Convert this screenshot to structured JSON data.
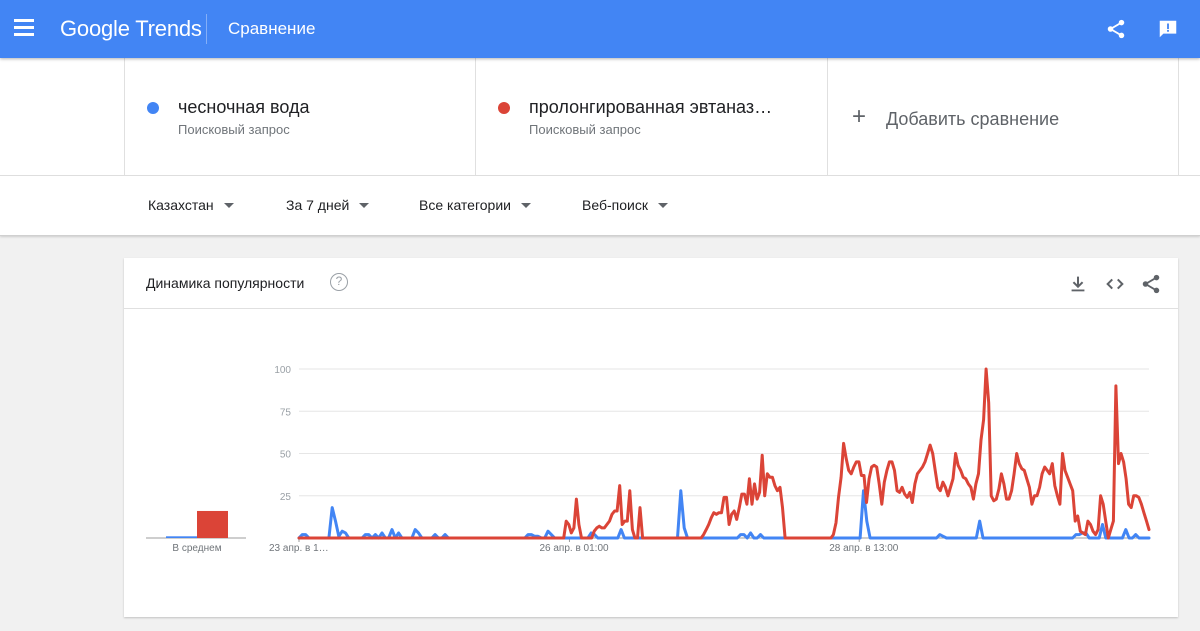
{
  "header": {
    "brand": "Google Trends",
    "page_title": "Сравнение",
    "accent_color": "#4285f4"
  },
  "terms": [
    {
      "name": "чесночная вода",
      "type": "Поисковый запрос",
      "color": "#4285f4"
    },
    {
      "name": "пролонгированная эвтаназ…",
      "type": "Поисковый запрос",
      "color": "#db4437"
    }
  ],
  "add_comparison": {
    "label": "Добавить сравнение",
    "icon": "plus-icon"
  },
  "filters": [
    {
      "label": "Казахстан"
    },
    {
      "label": "За 7 дней"
    },
    {
      "label": "Все категории"
    },
    {
      "label": "Веб-поиск"
    }
  ],
  "card": {
    "title": "Динамика популярности",
    "help_glyph": "?",
    "icons": [
      "download-icon",
      "embed-icon",
      "share-icon"
    ]
  },
  "chart_data": {
    "type": "line",
    "yticks": [
      "100",
      "75",
      "50",
      "25"
    ],
    "ylim": [
      0,
      100
    ],
    "xtick_labels": [
      "23 апр. в 1…",
      "26 апр. в 01:00",
      "28 апр. в 13:00"
    ],
    "xtick_positions": [
      0,
      28,
      58
    ],
    "average_label": "В среднем",
    "average_values": [
      1,
      16
    ],
    "grid": true,
    "series": [
      {
        "color": "#4285f4",
        "values": [
          0,
          2,
          2,
          0,
          0,
          0,
          0,
          0,
          0,
          0,
          18,
          10,
          1,
          4,
          3,
          0,
          0,
          0,
          0,
          0,
          2,
          2,
          0,
          2,
          0,
          3,
          0,
          0,
          5,
          0,
          3,
          0,
          0,
          0,
          0,
          5,
          3,
          0,
          0,
          0,
          0,
          2,
          0,
          0,
          2,
          0,
          0,
          0,
          0,
          0,
          0,
          0,
          0,
          0,
          0,
          0,
          0,
          0,
          0,
          0,
          0,
          0,
          0,
          0,
          0,
          0,
          0,
          0,
          0,
          2,
          2,
          1,
          1,
          0,
          0,
          4,
          2,
          0,
          0,
          0,
          0,
          0,
          0,
          0,
          0,
          0,
          0,
          0,
          3,
          2,
          0,
          0,
          0,
          0,
          0,
          0,
          0,
          5,
          0,
          0,
          0,
          0,
          0,
          0,
          0,
          0,
          0,
          0,
          0,
          0,
          0,
          0,
          0,
          0,
          0,
          28,
          6,
          0,
          0,
          0,
          0,
          0,
          0,
          0,
          0,
          0,
          0,
          0,
          0,
          0,
          0,
          0,
          0,
          2,
          2,
          0,
          3,
          0,
          0,
          2,
          0,
          0,
          0,
          0,
          0,
          0,
          0,
          0,
          0,
          0,
          0,
          0,
          0,
          0,
          0,
          0,
          0,
          0,
          0,
          0,
          0,
          0,
          0,
          0,
          0,
          0,
          0,
          0,
          0,
          0,
          28,
          10,
          0,
          0,
          0,
          0,
          0,
          0,
          0,
          0,
          0,
          0,
          0,
          0,
          0,
          0,
          0,
          0,
          0,
          0,
          0,
          0,
          0,
          2,
          1,
          0,
          0,
          0,
          0,
          0,
          0,
          0,
          0,
          0,
          0,
          10,
          0,
          0,
          0,
          0,
          0,
          0,
          0,
          0,
          0,
          0,
          0,
          0,
          0,
          0,
          0,
          0,
          0,
          0,
          0,
          0,
          0,
          0,
          0,
          0,
          0,
          0,
          0,
          0,
          2,
          2,
          3,
          3,
          0,
          0,
          0,
          0,
          8,
          0,
          0,
          0,
          0,
          0,
          0,
          5,
          0,
          0,
          2,
          0,
          0,
          0,
          0
        ]
      },
      {
        "color": "#db4437",
        "values": [
          0,
          0,
          0,
          0,
          0,
          0,
          0,
          0,
          0,
          0,
          0,
          0,
          0,
          0,
          0,
          0,
          0,
          0,
          0,
          0,
          0,
          0,
          0,
          0,
          0,
          0,
          0,
          0,
          0,
          0,
          0,
          0,
          0,
          0,
          0,
          0,
          0,
          0,
          0,
          0,
          0,
          0,
          0,
          0,
          0,
          0,
          0,
          0,
          0,
          0,
          0,
          0,
          0,
          0,
          0,
          0,
          0,
          0,
          0,
          0,
          0,
          0,
          0,
          0,
          0,
          0,
          0,
          0,
          0,
          0,
          0,
          0,
          0,
          0,
          0,
          0,
          0,
          0,
          0,
          0,
          0,
          0,
          0,
          0,
          0,
          0,
          0,
          0,
          0,
          0,
          0,
          0,
          0,
          0,
          0,
          0,
          0,
          0,
          0,
          0,
          0,
          0,
          0,
          0,
          0,
          10,
          8,
          3,
          6,
          23,
          8,
          0,
          0,
          0,
          0,
          0,
          4,
          6,
          7,
          6,
          6,
          8,
          10,
          14,
          16,
          16,
          31,
          8,
          10,
          10,
          28,
          5,
          0,
          0,
          18,
          0,
          0,
          0,
          0,
          0,
          0,
          0,
          0,
          0,
          0,
          0,
          0,
          0,
          0,
          0,
          0,
          0,
          0,
          0,
          0,
          0,
          0,
          0,
          0,
          2,
          5,
          8,
          12,
          15,
          14,
          15,
          15,
          24,
          24,
          8,
          14,
          16,
          11,
          18,
          26,
          26,
          20,
          35,
          20,
          32,
          23,
          27,
          49,
          25,
          38,
          36,
          36,
          31,
          28,
          30,
          18,
          0,
          0,
          0,
          0,
          0,
          0,
          0,
          0,
          0,
          0,
          0,
          0,
          0,
          0,
          0,
          0,
          0,
          0,
          0,
          2,
          9,
          24,
          36,
          56,
          47,
          40,
          38,
          42,
          45,
          45,
          37,
          37,
          21,
          35,
          42,
          43,
          42,
          32,
          20,
          33,
          40,
          45,
          45,
          40,
          28,
          27,
          30,
          26,
          24,
          27,
          21,
          32,
          38,
          40,
          42,
          45,
          50,
          55,
          50,
          40,
          30,
          28,
          33,
          30,
          25,
          30,
          35,
          50,
          43,
          40,
          36,
          35,
          32,
          30,
          23,
          32,
          38,
          58,
          70,
          100,
          80,
          25,
          22,
          23,
          29,
          38,
          32,
          23,
          23,
          28,
          38,
          50,
          44,
          41,
          40,
          35,
          30,
          20,
          25,
          25,
          30,
          38,
          42,
          40,
          38,
          44,
          31,
          25,
          20,
          50,
          40,
          36,
          32,
          28,
          10,
          13,
          4,
          3,
          2,
          10,
          8,
          4,
          2,
          5,
          25,
          20,
          10,
          0,
          5,
          10,
          90,
          44,
          50,
          45,
          35,
          20,
          18,
          25,
          25,
          24,
          20,
          15,
          10,
          5
        ]
      }
    ]
  }
}
